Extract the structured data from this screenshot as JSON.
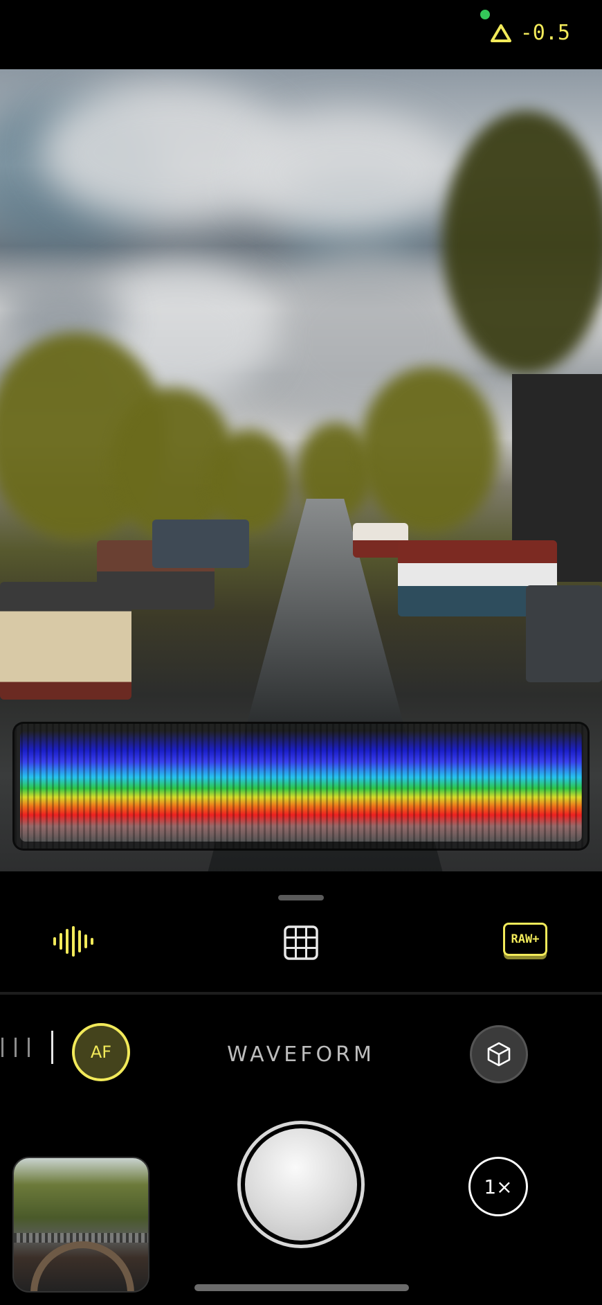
{
  "status": {
    "exposure_value": "-0.5",
    "exposure_icon": "triangle-exposure-icon",
    "privacy_indicator": "green-dot"
  },
  "viewfinder": {
    "scene": "canal-with-trees-and-houseboats"
  },
  "waveform_panel": {
    "visible": true
  },
  "toolbar": {
    "waveform_icon": "waveform-icon",
    "grid_icon": "grid-icon",
    "raw_label": "RAW+"
  },
  "controls": {
    "af_label": "AF",
    "mode_label": "WAVEFORM",
    "depth_icon": "cube-icon"
  },
  "capture": {
    "zoom_label": "1×"
  },
  "colors": {
    "accent": "#f2ea5a",
    "background": "#000000",
    "privacy_dot": "#34c759"
  }
}
